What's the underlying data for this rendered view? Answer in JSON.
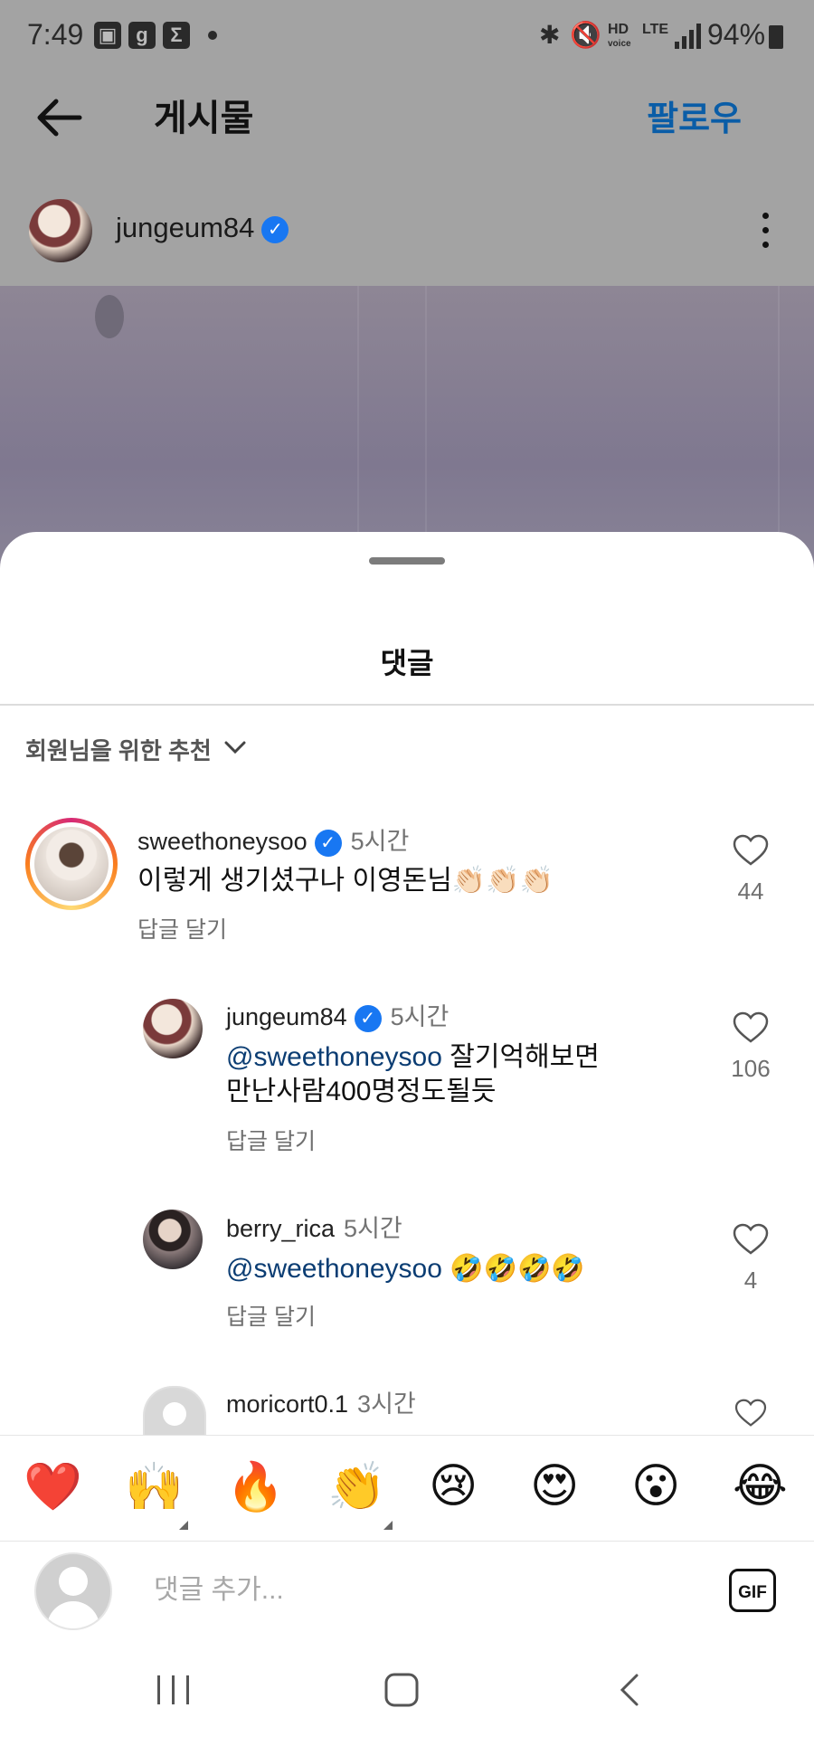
{
  "status_bar": {
    "time": "7:49",
    "battery": "94%",
    "icons": [
      "image-icon",
      "g-icon",
      "sigma-icon",
      "dot-icon",
      "bluetooth-icon",
      "mute-icon",
      "hd-voice-icon",
      "lte-icon",
      "signal-icon",
      "battery-icon"
    ]
  },
  "header": {
    "title": "게시물",
    "follow_label": "팔로우"
  },
  "post": {
    "username": "jungeum84"
  },
  "sheet": {
    "title": "댓글",
    "filter_label": "회원님을 위한 추천"
  },
  "comments": [
    {
      "username": "sweethoneysoo",
      "verified": true,
      "time": "5시간",
      "text": "이렇게 생기셨구나 이영돈님👏🏻👏🏻👏🏻",
      "reply_label": "답글 달기",
      "likes": "44"
    },
    {
      "username": "jungeum84",
      "verified": true,
      "time": "5시간",
      "mention": "@sweethoneysoo",
      "text_line1": " 잘기억해보면",
      "text_line2": "만난사람400명정도될듯",
      "reply_label": "답글 달기",
      "likes": "106"
    },
    {
      "username": "berry_rica",
      "verified": false,
      "time": "5시간",
      "mention": "@sweethoneysoo",
      "text": " 🤣🤣🤣🤣",
      "reply_label": "답글 달기",
      "likes": "4"
    },
    {
      "username": "moricort0.1",
      "verified": false,
      "time": "3시간"
    }
  ],
  "emoji_bar": [
    "❤️",
    "🙌",
    "🔥",
    "👏",
    "😢",
    "😍",
    "😮",
    "😂"
  ],
  "input": {
    "placeholder": "댓글 추가...",
    "gif_label": "GIF"
  },
  "colors": {
    "accent": "#0a5da7",
    "verified": "#1877f2",
    "mention": "#0b3d73"
  }
}
